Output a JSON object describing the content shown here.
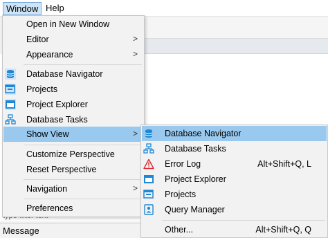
{
  "menubar": {
    "window_label": "Window",
    "help_label": "Help"
  },
  "background": {
    "filter_hint": "type filter text",
    "message_tab": "Message"
  },
  "window_menu": {
    "open_new_window": "Open in New Window",
    "editor": "Editor",
    "appearance": "Appearance",
    "database_navigator": "Database Navigator",
    "projects": "Projects",
    "project_explorer": "Project Explorer",
    "database_tasks": "Database Tasks",
    "show_view": "Show View",
    "customize_perspective": "Customize Perspective",
    "reset_perspective": "Reset Perspective",
    "navigation": "Navigation",
    "preferences": "Preferences",
    "submenu_arrow": ">"
  },
  "show_view_menu": {
    "database_navigator": "Database Navigator",
    "database_tasks": "Database Tasks",
    "error_log": "Error Log",
    "error_log_shortcut": "Alt+Shift+Q, L",
    "project_explorer": "Project Explorer",
    "projects": "Projects",
    "query_manager": "Query Manager",
    "other": "Other...",
    "other_shortcut": "Alt+Shift+Q, Q"
  },
  "colors": {
    "selection": "#99c9ef",
    "menu_background": "#f2f2f2",
    "icon_blue": "#1e88d6",
    "error_red": "#d9282f"
  }
}
